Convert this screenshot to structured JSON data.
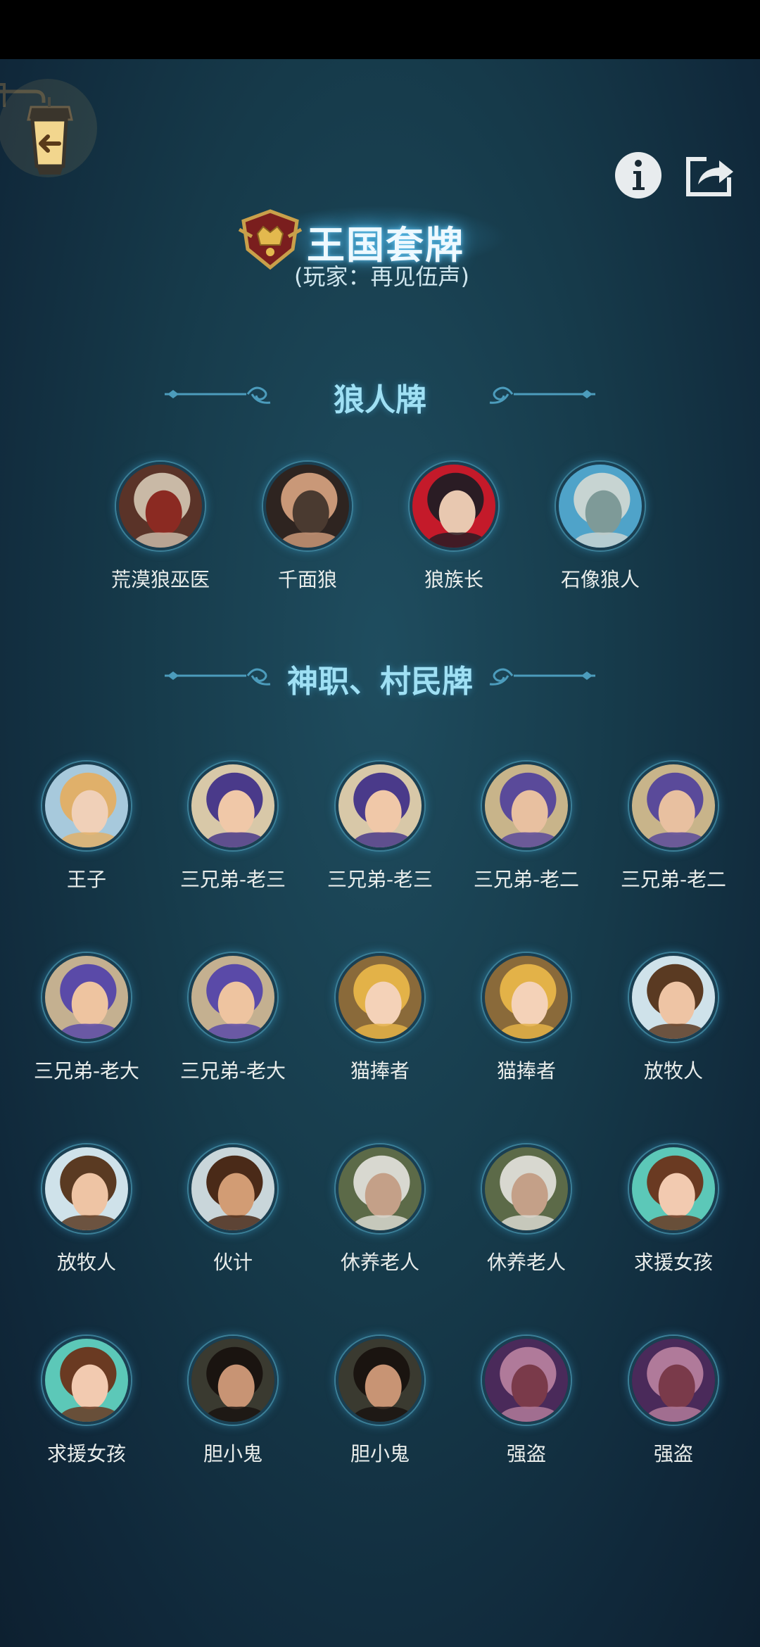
{
  "nav": {
    "back_icon": "lantern-back-arrow-icon",
    "info_icon": "info-icon",
    "share_icon": "share-icon"
  },
  "deck": {
    "title": "王国套牌",
    "player": "(玩家：再见伍声)",
    "emblem_icon": "crown-shield-emblem-icon"
  },
  "sections": {
    "werewolf_title": "狼人牌",
    "villager_title": "神职、村民牌"
  },
  "werewolf_cards": [
    {
      "name": "荒漠狼巫医",
      "art": "horned-wolf-shaman-portrait",
      "colors": [
        "#5a3328",
        "#c9b9a6",
        "#8b2a22"
      ]
    },
    {
      "name": "千面狼",
      "art": "long-haired-man-portrait",
      "colors": [
        "#2e2420",
        "#c99878",
        "#4a3a30"
      ]
    },
    {
      "name": "狼族长",
      "art": "wolf-chief-red-banner-portrait",
      "colors": [
        "#c41a2a",
        "#2a1c24",
        "#e8c8b0"
      ]
    },
    {
      "name": "石像狼人",
      "art": "stone-wolf-statue-portrait",
      "colors": [
        "#4fa3c9",
        "#c7d4d2",
        "#7e9a98"
      ]
    }
  ],
  "villager_cards": [
    {
      "name": "王子",
      "art": "blond-prince-portrait",
      "colors": [
        "#a7c9dc",
        "#e0b06a",
        "#f0d0b8"
      ]
    },
    {
      "name": "三兄弟-老三",
      "art": "violinist-purple-hair-portrait",
      "colors": [
        "#d8c8a8",
        "#4a3a8a",
        "#f0c8a8"
      ]
    },
    {
      "name": "三兄弟-老三",
      "art": "violinist-purple-hair-portrait",
      "colors": [
        "#d8c8a8",
        "#4a3a8a",
        "#f0c8a8"
      ]
    },
    {
      "name": "三兄弟-老二",
      "art": "purple-hair-musician-portrait",
      "colors": [
        "#c8b48a",
        "#5a4a9a",
        "#e8c0a0"
      ]
    },
    {
      "name": "三兄弟-老二",
      "art": "purple-hair-musician-portrait",
      "colors": [
        "#c8b48a",
        "#5a4a9a",
        "#e8c0a0"
      ]
    },
    {
      "name": "三兄弟-老大",
      "art": "purple-hair-young-man-portrait",
      "colors": [
        "#c4b090",
        "#5a4aa8",
        "#eec4a0"
      ]
    },
    {
      "name": "三兄弟-老大",
      "art": "purple-hair-young-man-portrait",
      "colors": [
        "#c4b090",
        "#5a4aa8",
        "#eec4a0"
      ]
    },
    {
      "name": "猫捧者",
      "art": "curly-blonde-girl-portrait",
      "colors": [
        "#8a6a3a",
        "#e3b248",
        "#f4d2b8"
      ]
    },
    {
      "name": "猫捧者",
      "art": "curly-blonde-girl-portrait",
      "colors": [
        "#8a6a3a",
        "#e3b248",
        "#f4d2b8"
      ]
    },
    {
      "name": "放牧人",
      "art": "brown-hair-shepherd-portrait",
      "colors": [
        "#cfe2ea",
        "#5a3a22",
        "#eec4a4"
      ]
    },
    {
      "name": "放牧人",
      "art": "brown-hair-shepherd-portrait",
      "colors": [
        "#cfe2ea",
        "#5a3a22",
        "#eec4a4"
      ]
    },
    {
      "name": "伙计",
      "art": "bearded-man-portrait",
      "colors": [
        "#c9d6da",
        "#4a2a18",
        "#d29c74"
      ]
    },
    {
      "name": "休养老人",
      "art": "old-white-haired-woman-portrait",
      "colors": [
        "#5c6a48",
        "#d8d8d0",
        "#c4a088"
      ]
    },
    {
      "name": "休养老人",
      "art": "old-white-haired-woman-portrait",
      "colors": [
        "#5c6a48",
        "#d8d8d0",
        "#c4a088"
      ]
    },
    {
      "name": "求援女孩",
      "art": "brown-hair-girl-portrait",
      "colors": [
        "#5cc8b8",
        "#6a3a22",
        "#f2cab0"
      ]
    },
    {
      "name": "求援女孩",
      "art": "brown-hair-girl-portrait",
      "colors": [
        "#5cc8b8",
        "#6a3a22",
        "#f2cab0"
      ]
    },
    {
      "name": "胆小鬼",
      "art": "long-dark-hair-man-portrait",
      "colors": [
        "#3a3a30",
        "#1a1410",
        "#c89474"
      ]
    },
    {
      "name": "胆小鬼",
      "art": "long-dark-hair-man-portrait",
      "colors": [
        "#3a3a30",
        "#1a1410",
        "#c89474"
      ]
    },
    {
      "name": "强盗",
      "art": "bald-eyepatch-bandit-portrait",
      "colors": [
        "#4a2a5a",
        "#b07a9a",
        "#7a3a4a"
      ]
    },
    {
      "name": "强盗",
      "art": "bald-eyepatch-bandit-portrait",
      "colors": [
        "#4a2a5a",
        "#b07a9a",
        "#7a3a4a"
      ]
    }
  ],
  "colors": {
    "background": "#163a4a",
    "title_glow": "#50bef0",
    "section_title": "#9fe0f4",
    "card_text": "#e9edeb"
  }
}
